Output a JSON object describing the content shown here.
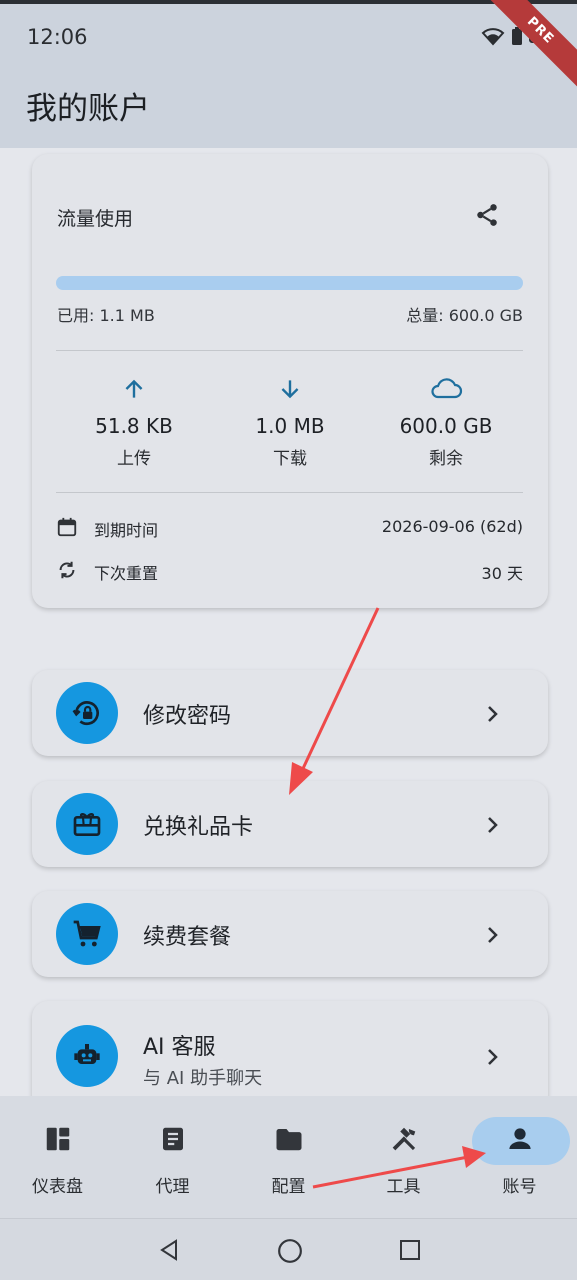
{
  "status_bar": {
    "time": "12:06"
  },
  "debug_banner": "PRE",
  "header": {
    "title": "我的账户"
  },
  "usage": {
    "title": "流量使用",
    "progress_fraction": 2e-06,
    "used": "已用: 1.1 MB",
    "total": "总量: 600.0 GB",
    "stats": [
      {
        "icon": "arrow-up-icon",
        "value": "51.8 KB",
        "label": "上传"
      },
      {
        "icon": "arrow-down-icon",
        "value": "1.0 MB",
        "label": "下载"
      },
      {
        "icon": "cloud-icon",
        "value": "600.0 GB",
        "label": "剩余"
      }
    ],
    "expiry": {
      "label": "到期时间",
      "value": "2026-09-06 (62d)"
    },
    "reset": {
      "label": "下次重置",
      "value": "30 天"
    }
  },
  "menu": [
    {
      "icon": "lock-reset-icon",
      "label": "修改密码"
    },
    {
      "icon": "gift-card-icon",
      "label": "兑换礼品卡"
    },
    {
      "icon": "shopping-cart-icon",
      "label": "续费套餐"
    },
    {
      "icon": "robot-icon",
      "label": "AI 客服",
      "sub": "与 AI 助手聊天"
    }
  ],
  "bottom_nav": [
    {
      "icon": "dashboard-icon",
      "label": "仪表盘"
    },
    {
      "icon": "list-icon",
      "label": "代理"
    },
    {
      "icon": "folder-icon",
      "label": "配置"
    },
    {
      "icon": "tools-icon",
      "label": "工具"
    },
    {
      "icon": "person-icon",
      "label": "账号",
      "active": true
    }
  ],
  "colors": {
    "accent": "#1597e0",
    "progress_track": "#a9cdef",
    "active_pill": "#a8cdee",
    "annotation_arrow": "#ee4a4a"
  }
}
